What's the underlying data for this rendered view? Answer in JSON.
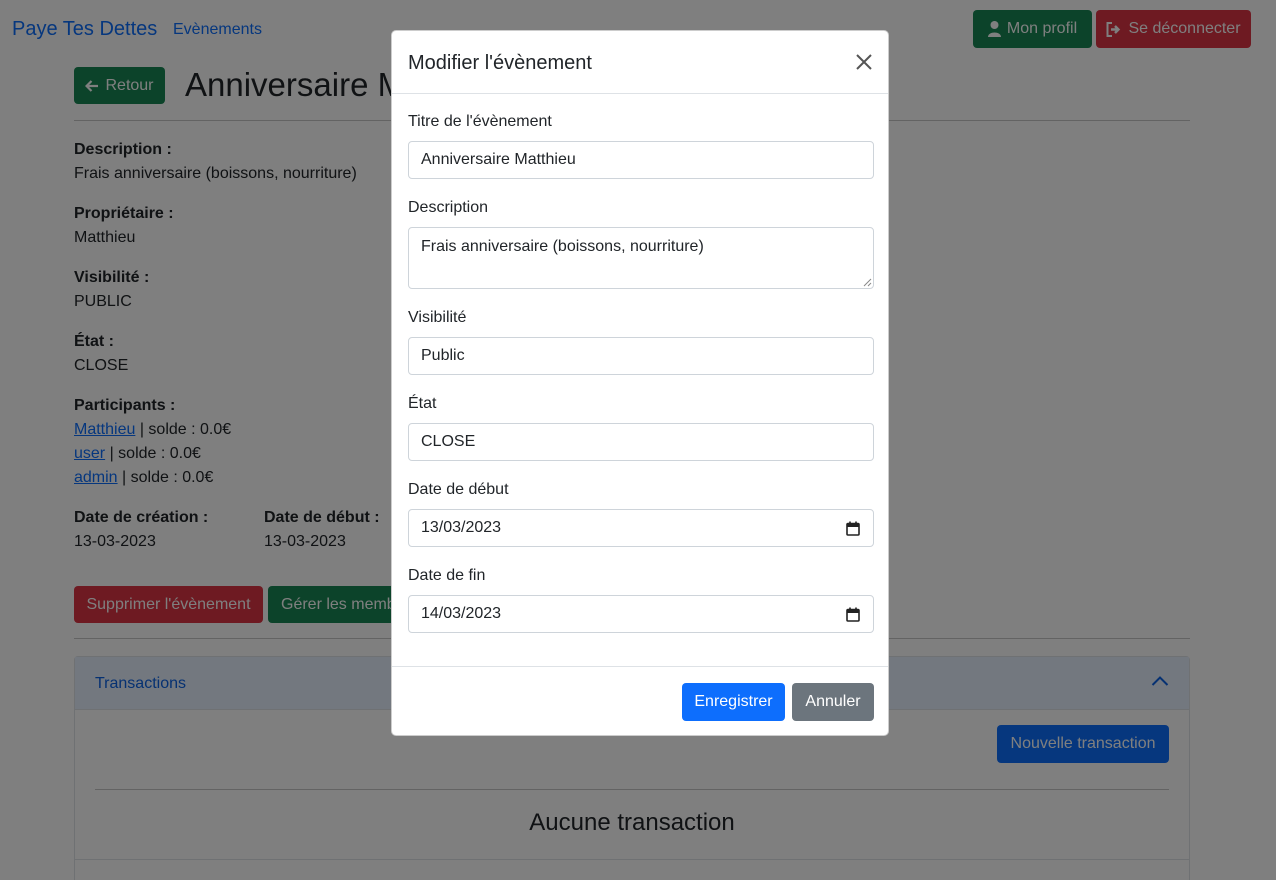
{
  "navbar": {
    "brand": "Paye Tes Dettes",
    "events_link": "Evènements",
    "profile_button": "Mon profil",
    "logout_button": "Se déconnecter"
  },
  "page": {
    "back_button": "Retour",
    "title": "Anniversaire Matthieu",
    "description_label": "Description :",
    "description_value": "Frais anniversaire (boissons, nourriture)",
    "owner_label": "Propriétaire :",
    "owner_value": "Matthieu",
    "visibility_label": "Visibilité :",
    "visibility_value": "PUBLIC",
    "state_label": "État :",
    "state_value": "CLOSE",
    "participants_label": "Participants :",
    "participants": [
      {
        "name": "Matthieu",
        "balance": " | solde : 0.0€"
      },
      {
        "name": "user",
        "balance": " | solde : 0.0€"
      },
      {
        "name": "admin",
        "balance": " | solde : 0.0€"
      }
    ],
    "created_label": "Date de création :",
    "created_value": "13-03-2023",
    "start_label": "Date de début :",
    "start_value": "13-03-2023",
    "delete_button": "Supprimer l'évènement",
    "manage_button": "Gérer les membres",
    "transactions_title": "Transactions",
    "new_transaction_button": "Nouvelle transaction",
    "no_transaction": "Aucune transaction"
  },
  "modal": {
    "title": "Modifier l'évènement",
    "title_label": "Titre de l'évènement",
    "title_value": "Anniversaire Matthieu",
    "description_label": "Description",
    "description_value": "Frais anniversaire (boissons, nourriture)",
    "visibility_label": "Visibilité",
    "visibility_value": "Public",
    "state_label": "État",
    "state_value": "CLOSE",
    "start_label": "Date de début",
    "start_value": "13/03/2023",
    "end_label": "Date de fin",
    "end_value": "14/03/2023",
    "save_button": "Enregistrer",
    "cancel_button": "Annuler"
  },
  "colors": {
    "primary": "#0d6efd",
    "success": "#198754",
    "danger": "#dc3545",
    "secondary": "#6c757d"
  }
}
